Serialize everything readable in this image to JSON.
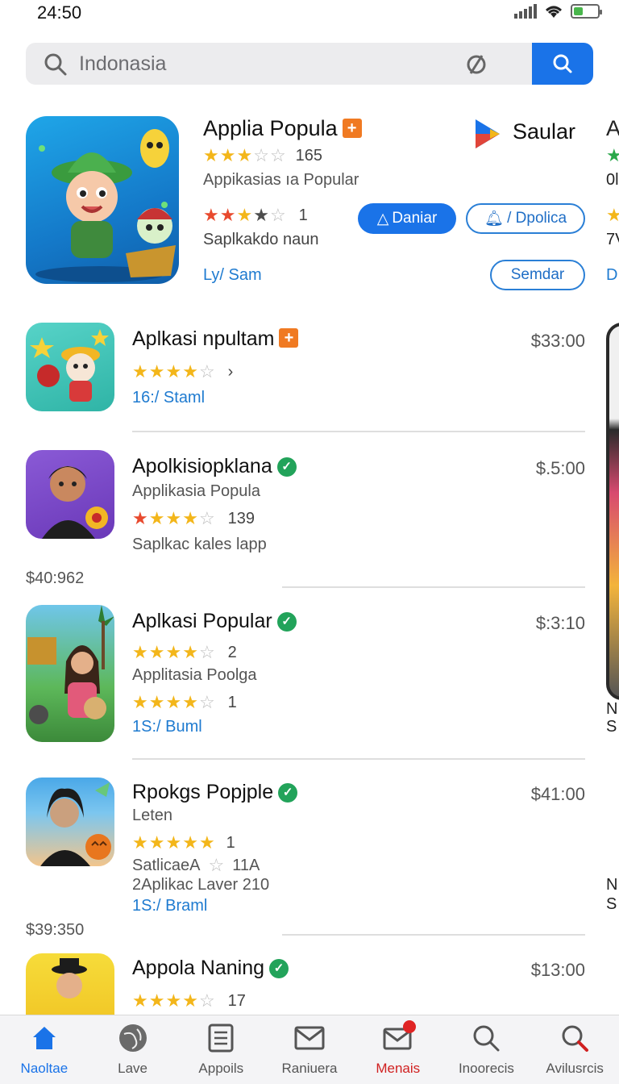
{
  "status_bar": {
    "time": "24:50"
  },
  "search": {
    "value": "Indonasia",
    "placeholder": "Indonasia"
  },
  "featured": {
    "title": "Applia Popula",
    "rating_count": "165",
    "subtitle": "Appikasias ıa Popular",
    "rating2_count": "1",
    "caption": "Saplkakdo naun",
    "author": "Ly/ Sam",
    "store_name": "Saular",
    "install_button": "Daniar",
    "secondary_button": "/ Dpolica",
    "similar_button": "Semdar",
    "edge_peek": [
      "A",
      "0l",
      "7V",
      "D"
    ]
  },
  "apps": [
    {
      "title": "Aplkasi npultam",
      "badge": "plus",
      "price": "$33:00",
      "rating_value": 4,
      "extra": "›",
      "link": "16:/ Staml"
    },
    {
      "title": "Apolkisiopklana",
      "badge": "verified",
      "price": "$.5:00",
      "subtitle": "Applikasia Popula",
      "rating_count": "139",
      "caption": "Saplkac kales lapp"
    },
    {
      "title": "Aplkasi Popular",
      "badge": "verified",
      "price": "$:3:10",
      "rating_count": "2",
      "subtitle": "Applitasia Poolga",
      "rating2_count": "1",
      "link": "1S:/ Buml"
    },
    {
      "title": "Rpokgs Popjple",
      "badge": "verified",
      "price": "$41:00",
      "subtitle": "Leten",
      "rating_count": "1",
      "line2": "SatlicaeA",
      "line2_value": "11A",
      "line3": "2Aplikac Laver 210",
      "link": "1S:/ Braml"
    },
    {
      "title": "Appola Naning",
      "badge": "verified",
      "price": "$13:00",
      "rating_count": "17"
    }
  ],
  "floating_prices": [
    "$40:962",
    "$39:350"
  ],
  "edge_labels": [
    "N",
    "S",
    "N",
    "S"
  ],
  "bottom_nav": [
    {
      "label": "Naoltae",
      "icon": "home-icon",
      "active": true
    },
    {
      "label": "Lave",
      "icon": "globe-icon"
    },
    {
      "label": "Appoils",
      "icon": "document-icon"
    },
    {
      "label": "Raniuera",
      "icon": "mail-icon"
    },
    {
      "label": "Menais",
      "icon": "message-alert-icon",
      "alert": true
    },
    {
      "label": "Inoorecis",
      "icon": "search-icon"
    },
    {
      "label": "Avilusrcis",
      "icon": "search-red-icon"
    }
  ],
  "colors": {
    "accent": "#1a73e8",
    "verified": "#22a35a",
    "plus_badge": "#f07a22",
    "star": "#f3b61a"
  }
}
